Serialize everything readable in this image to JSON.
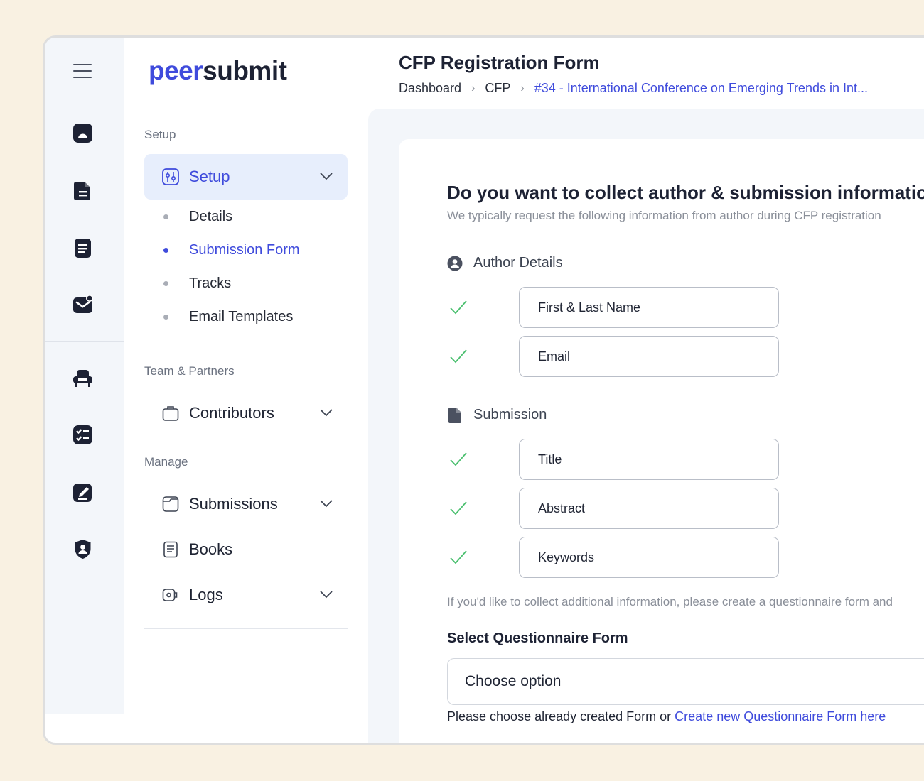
{
  "brand": {
    "part1": "peer",
    "part2": "submit"
  },
  "header": {
    "title": "CFP Registration Form",
    "breadcrumb": [
      "Dashboard",
      "CFP",
      "#34 - International Conference on Emerging Trends in Int..."
    ]
  },
  "rail": {
    "icons": [
      "menu-icon",
      "presentation-icon",
      "document-icon",
      "note-icon",
      "mail-notification-icon",
      "armchair-icon",
      "checklist-icon",
      "edit-icon",
      "shield-user-icon"
    ]
  },
  "sidebar": {
    "sections": {
      "setup": "Setup",
      "team": "Team & Partners",
      "manage": "Manage"
    },
    "setup_item": "Setup",
    "setup_sub": [
      "Details",
      "Submission Form",
      "Tracks",
      "Email Templates"
    ],
    "contributors": "Contributors",
    "submissions": "Submissions",
    "books": "Books",
    "logs": "Logs"
  },
  "form": {
    "question": "Do you want to collect author & submission information",
    "subtitle": "We typically request the following information from author during CFP registration",
    "author_group": "Author Details",
    "author_fields": [
      "First & Last Name",
      "Email"
    ],
    "submission_group": "Submission",
    "submission_fields": [
      "Title",
      "Abstract",
      "Keywords"
    ],
    "note": "If you'd like to collect additional information, please create a questionnaire form and",
    "select_label": "Select Questionnaire Form",
    "select_value": "Choose option",
    "help_text": "Please choose already created Form or ",
    "help_link": "Create new Questionnaire Form here"
  },
  "colors": {
    "accent": "#3f4bdc",
    "check": "#4cc070",
    "background": "#f9f1e2"
  }
}
